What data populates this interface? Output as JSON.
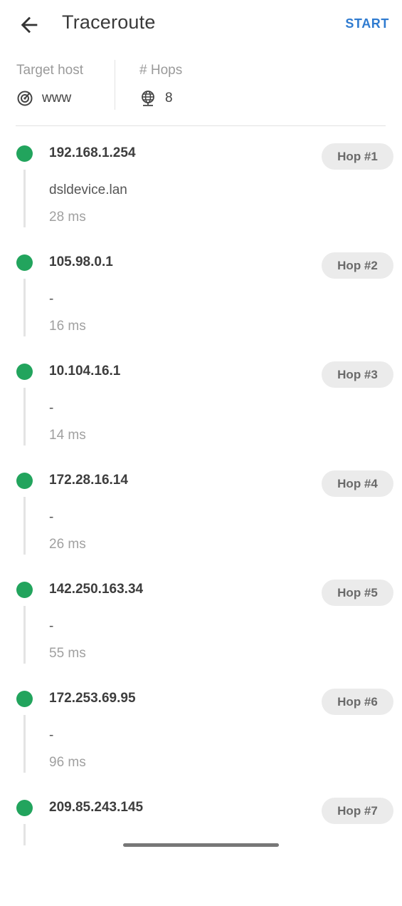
{
  "header": {
    "title": "Traceroute",
    "start_label": "START"
  },
  "summary": {
    "target_label": "Target host",
    "target_value": "www",
    "target_icon": "target-icon",
    "hops_label": "# Hops",
    "hops_value": "8",
    "hops_icon": "globe-icon"
  },
  "hops": [
    {
      "ip": "192.168.1.254",
      "host": "dsldevice.lan",
      "time": "28 ms",
      "chip": "Hop #1"
    },
    {
      "ip": "105.98.0.1",
      "host": "-",
      "time": "16 ms",
      "chip": "Hop #2"
    },
    {
      "ip": "10.104.16.1",
      "host": "-",
      "time": "14 ms",
      "chip": "Hop #3"
    },
    {
      "ip": "172.28.16.14",
      "host": "-",
      "time": "26 ms",
      "chip": "Hop #4"
    },
    {
      "ip": "142.250.163.34",
      "host": "-",
      "time": "55 ms",
      "chip": "Hop #5"
    },
    {
      "ip": "172.253.69.95",
      "host": "-",
      "time": "96 ms",
      "chip": "Hop #6"
    },
    {
      "ip": "209.85.243.145",
      "chip": "Hop #7"
    }
  ],
  "colors": {
    "status_ok": "#22a45d",
    "accent": "#2f7bd0"
  }
}
